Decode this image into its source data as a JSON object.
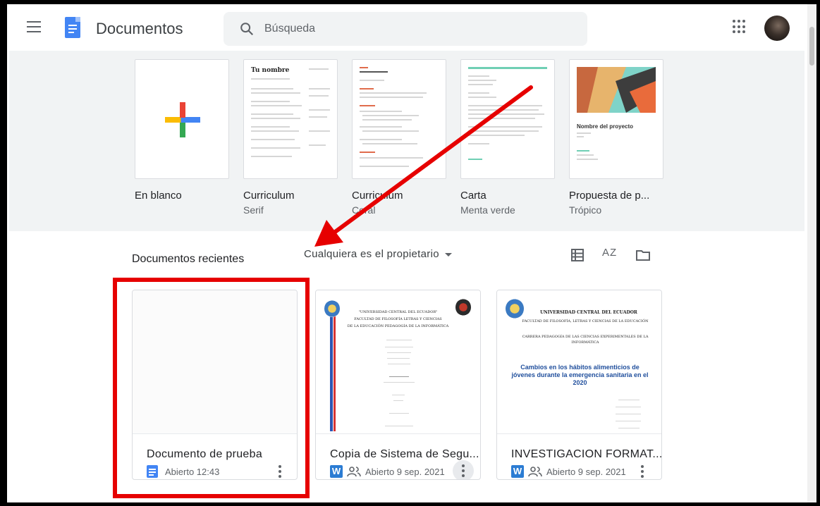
{
  "header": {
    "app_title": "Documentos",
    "search_placeholder": "Búsqueda"
  },
  "templates": [
    {
      "name": "En blanco",
      "subtitle": ""
    },
    {
      "name": "Curriculum",
      "subtitle": "Serif"
    },
    {
      "name": "Curriculum",
      "subtitle": "Coral"
    },
    {
      "name": "Carta",
      "subtitle": "Menta verde"
    },
    {
      "name": "Propuesta de p...",
      "subtitle": "Trópico"
    }
  ],
  "template_previews": {
    "serif_heading": "Tu nombre",
    "tropico_heading": "Nombre del proyecto"
  },
  "recent": {
    "title": "Documentos recientes",
    "owner_filter": "Cualquiera es el propietario",
    "sort_label": "AZ"
  },
  "documents": [
    {
      "name": "Documento de prueba",
      "meta": "Abierto 12:43",
      "type": "docs"
    },
    {
      "name": "Copia de Sistema de Segu...",
      "meta": "Abierto 9 sep. 2021",
      "type": "word",
      "shared": true
    },
    {
      "name": "INVESTIGACION FORMAT...",
      "meta": "Abierto 9 sep. 2021",
      "type": "word",
      "shared": true
    }
  ],
  "doc_previews": {
    "copia_header": "\"UNIVERSIDAD CENTRAL DEL ECUADOR\"",
    "copia_faculty": "FACULTAD DE FILOSOFÍA LETRAS Y CIENCIAS",
    "copia_career": "DE LA EDUCACIÓN PEDAGOGÍA DE LA INFORMÁTICA",
    "inv_header": "UNIVERSIDAD CENTRAL DEL ECUADOR",
    "inv_faculty": "FACULTAD DE FILOSOFÍA, LETRAS Y CIENCIAS DE LA EDUCACIÓN",
    "inv_career": "CARRERA PEDAGOGÍA DE LAS CIENCIAS EXPERIMENTALES DE LA INFORMÁTICA",
    "inv_title": "Cambios en los hábitos alimenticios de jóvenes durante la emergencia sanitaria en el 2020"
  },
  "colors": {
    "annotation_red": "#e60000",
    "docs_blue": "#4285f4",
    "word_blue": "#2b7cd3"
  }
}
